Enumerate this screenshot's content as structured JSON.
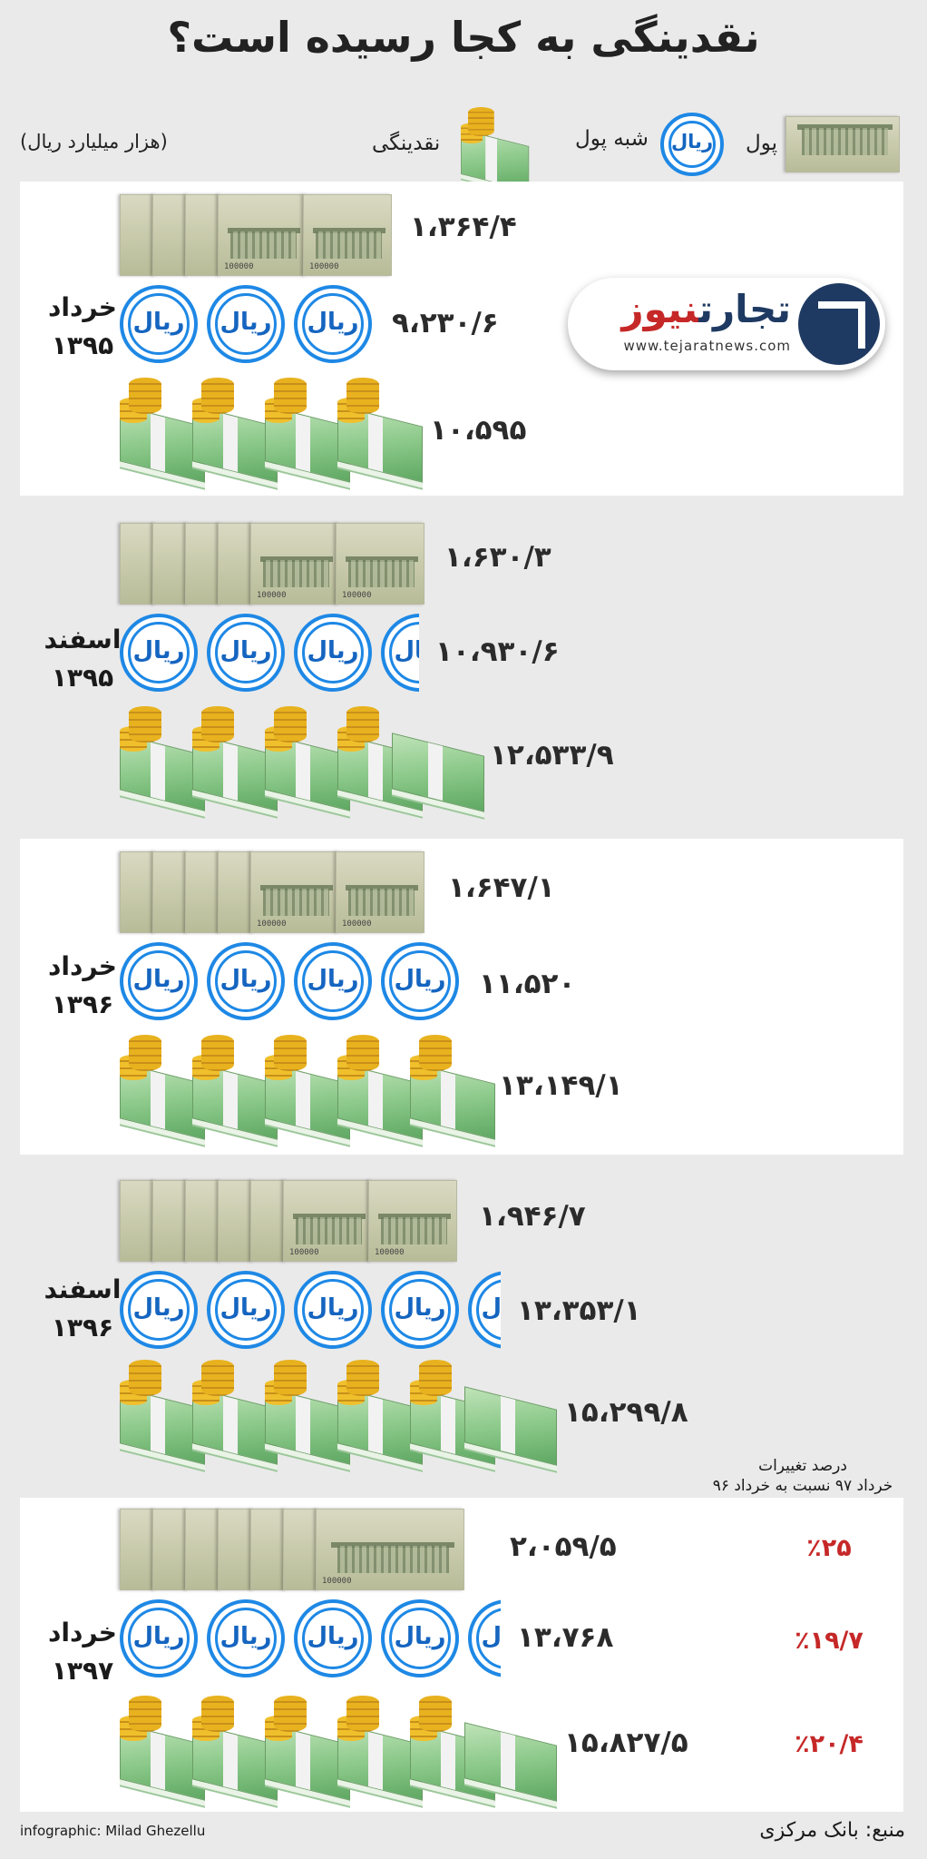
{
  "title": "نقدینگی به کجا رسیده است؟",
  "unit_note": "(هزار میلیارد ریال)",
  "legend": {
    "money": "پول",
    "quasi_money": "شبه پول",
    "liquidity": "نقدینگی",
    "coin_text": "ریال"
  },
  "logo": {
    "brand_part1": "تجارت",
    "brand_part2": "نیوز",
    "url": "www.tejaratnews.com"
  },
  "periods": [
    {
      "label_month": "خرداد",
      "label_year": "۱۳۹۵",
      "money": "۱،۳۶۴/۴",
      "quasi_money": "۹،۲۳۰/۶",
      "liquidity": "۱۰،۵۹۵"
    },
    {
      "label_month": "اسفند",
      "label_year": "۱۳۹۵",
      "money": "۱،۶۳۰/۳",
      "quasi_money": "۱۰،۹۳۰/۶",
      "liquidity": "۱۲،۵۳۳/۹"
    },
    {
      "label_month": "خرداد",
      "label_year": "۱۳۹۶",
      "money": "۱،۶۴۷/۱",
      "quasi_money": "۱۱،۵۲۰",
      "liquidity": "۱۳،۱۴۹/۱"
    },
    {
      "label_month": "اسفند",
      "label_year": "۱۳۹۶",
      "money": "۱،۹۴۶/۷",
      "quasi_money": "۱۳،۳۵۳/۱",
      "liquidity": "۱۵،۲۹۹/۸"
    },
    {
      "label_month": "خرداد",
      "label_year": "۱۳۹۷",
      "money": "۲،۰۵۹/۵",
      "quasi_money": "۱۳،۷۶۸",
      "liquidity": "۱۵،۸۲۷/۵"
    }
  ],
  "changes": {
    "heading_line1": "درصد تغییرات",
    "heading_line2": "خرداد ۹۷ نسبت به خرداد ۹۶",
    "money": "٪۲۵",
    "quasi_money": "٪۱۹/۷",
    "liquidity": "٪۲۰/۴"
  },
  "footer": {
    "credit": "infographic: Milad Ghezellu",
    "source": "منبع: بانک مرکزی"
  },
  "note_denomination": "100000",
  "colors": {
    "coin_blue": "#1e88e5",
    "percent_red": "#c62828",
    "panel_white": "#ffffff",
    "background": "#eaeaea"
  }
}
